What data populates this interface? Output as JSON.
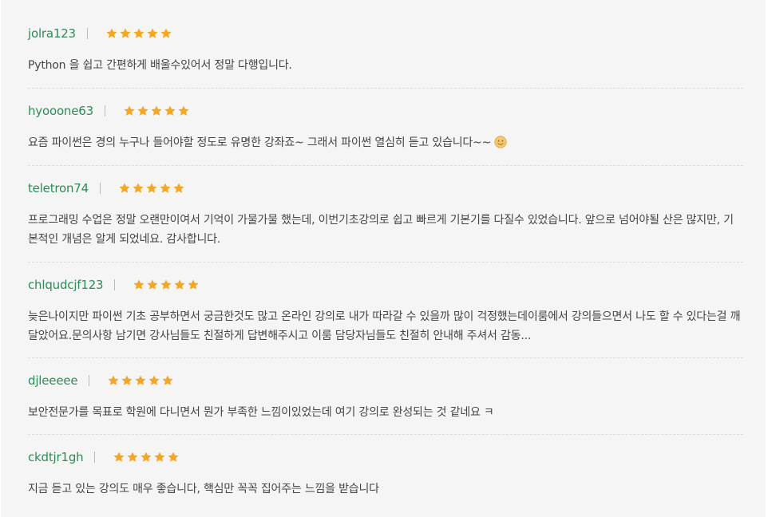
{
  "colors": {
    "username": "#2e8b57",
    "star": "#f5a623",
    "text": "#444444",
    "panel_bg": "#f5f5f5"
  },
  "reviews": [
    {
      "username": "jolra123",
      "rating": 5,
      "comment": "Python 을 쉽고 간편하게 배울수있어서 정말 다행입니다."
    },
    {
      "username": "hyooone63",
      "rating": 5,
      "comment": "요즘 파이썬은 경의 누구나 들어야할 정도로 유명한 강좌죠~ 그래서 파이썬 열심히 듣고 있습니다~~",
      "emoji": "smiling-face-emoji"
    },
    {
      "username": "teletron74",
      "rating": 5,
      "comment": "프로그래밍 수업은 정말 오랜만이여서 기억이 가물가물 했는데, 이번기초강의로 쉽고 빠르게 기본기를 다질수 있었습니다. 앞으로 넘어야될 산은 많지만, 기본적인 개념은 알게 되었네요. 감사합니다."
    },
    {
      "username": "chlqudcjf123",
      "rating": 5,
      "comment": "늦은나이지만 파이썬 기초 공부하면서 궁금한것도 많고 온라인 강의로 내가 따라갈 수 있을까 많이 걱정했는데이룸에서 강의들으면서 나도 할 수 있다는걸 깨달았어요.문의사항 남기면 강사님들도 친절하게 답변해주시고 이룸 담당자님들도 친절히 안내해 주셔서 감동..."
    },
    {
      "username": "djleeeee",
      "rating": 5,
      "comment": "보안전문가를 목표로 학원에 다니면서 뭔가 부족한 느낌이있었는데 여기 강의로 완성되는 것 같네요 ㅋ"
    },
    {
      "username": "ckdtjr1gh",
      "rating": 5,
      "comment": "지금 듣고 있는 강의도 매우 좋습니다, 핵심만 꼭꼭 집어주는 느낌을 받습니다"
    }
  ]
}
